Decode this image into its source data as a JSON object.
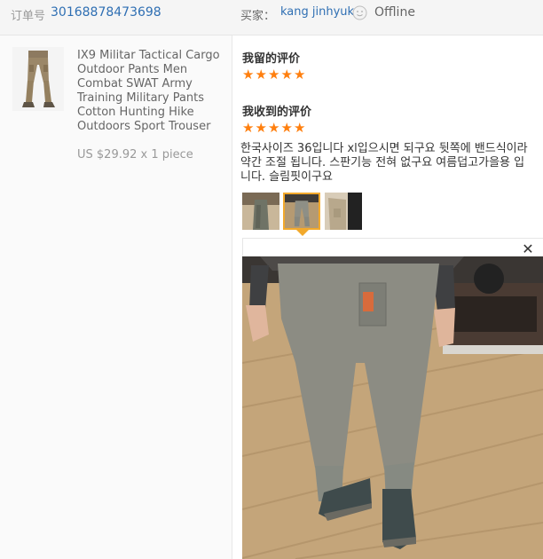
{
  "header": {
    "order_label": "订单号",
    "order_number": "30168878473698",
    "buyer_label": "买家：",
    "buyer_name": "kang jinhyuk",
    "status": "Offline",
    "status_icon": "smiley-icon"
  },
  "product": {
    "title": "IX9 Militar Tactical Cargo Outdoor Pants Men Combat SWAT Army Training Military Pants Cotton Hunting Hike Outdoors Sport Trouser",
    "price": "US $29.92 x 1 piece"
  },
  "my_review": {
    "heading": "我留的评价",
    "rating": 5
  },
  "received_review": {
    "heading": "我收到的评价",
    "rating": 5,
    "text": "한국사이즈 36입니다 xl입으시면 되구요 뒷쪽에 밴드식이라 약간 조절 됩니다. 스판기능 전혀 없구요 여름덥고가을용 입니다. 슬림핏이구요"
  },
  "review_photos": [
    "photo-1",
    "photo-2",
    "photo-3"
  ],
  "selected_photo": 2,
  "colors": {
    "link": "#2f6fb3",
    "star": "#ff7f0e",
    "selected_border": "#f2a92c"
  }
}
